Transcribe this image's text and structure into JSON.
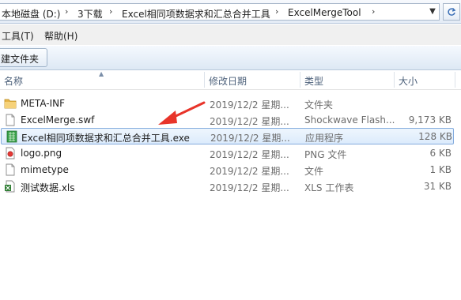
{
  "address": {
    "crumbs": [
      "本地磁盘 (D:)",
      "3下载",
      "Excel相同项数据求和汇总合并工具",
      "ExcelMergeTool"
    ],
    "separator": "›",
    "dropdown_icon": "chevron-down-icon"
  },
  "menu": [
    "工具(T)",
    "帮助(H)"
  ],
  "toolbar": {
    "new_folder_label": "建文件夹"
  },
  "columns": {
    "name": "名称",
    "date": "修改日期",
    "type": "类型",
    "size": "大小"
  },
  "files": [
    {
      "name": "META-INF",
      "date": "2019/12/2 星期...",
      "type": "文件夹",
      "size": "",
      "icon": "folder-icon",
      "selected": false
    },
    {
      "name": "ExcelMerge.swf",
      "date": "2019/12/2 星期...",
      "type": "Shockwave Flash...",
      "size": "9,173 KB",
      "icon": "swf-file-icon",
      "selected": false
    },
    {
      "name": "Excel相同项数据求和汇总合并工具.exe",
      "date": "2019/12/2 星期...",
      "type": "应用程序",
      "size": "128 KB",
      "icon": "exe-file-icon",
      "selected": true
    },
    {
      "name": "logo.png",
      "date": "2019/12/2 星期...",
      "type": "PNG 文件",
      "size": "6 KB",
      "icon": "png-file-icon",
      "selected": false
    },
    {
      "name": "mimetype",
      "date": "2019/12/2 星期...",
      "type": "文件",
      "size": "1 KB",
      "icon": "file-icon",
      "selected": false
    },
    {
      "name": "测试数据.xls",
      "date": "2019/12/2 星期...",
      "type": "XLS 工作表",
      "size": "31 KB",
      "icon": "xls-file-icon",
      "selected": false
    }
  ],
  "colors": {
    "selection_border": "#84acdd",
    "selection_fill": "#dcebfc",
    "annotation_arrow": "#e8342a"
  }
}
